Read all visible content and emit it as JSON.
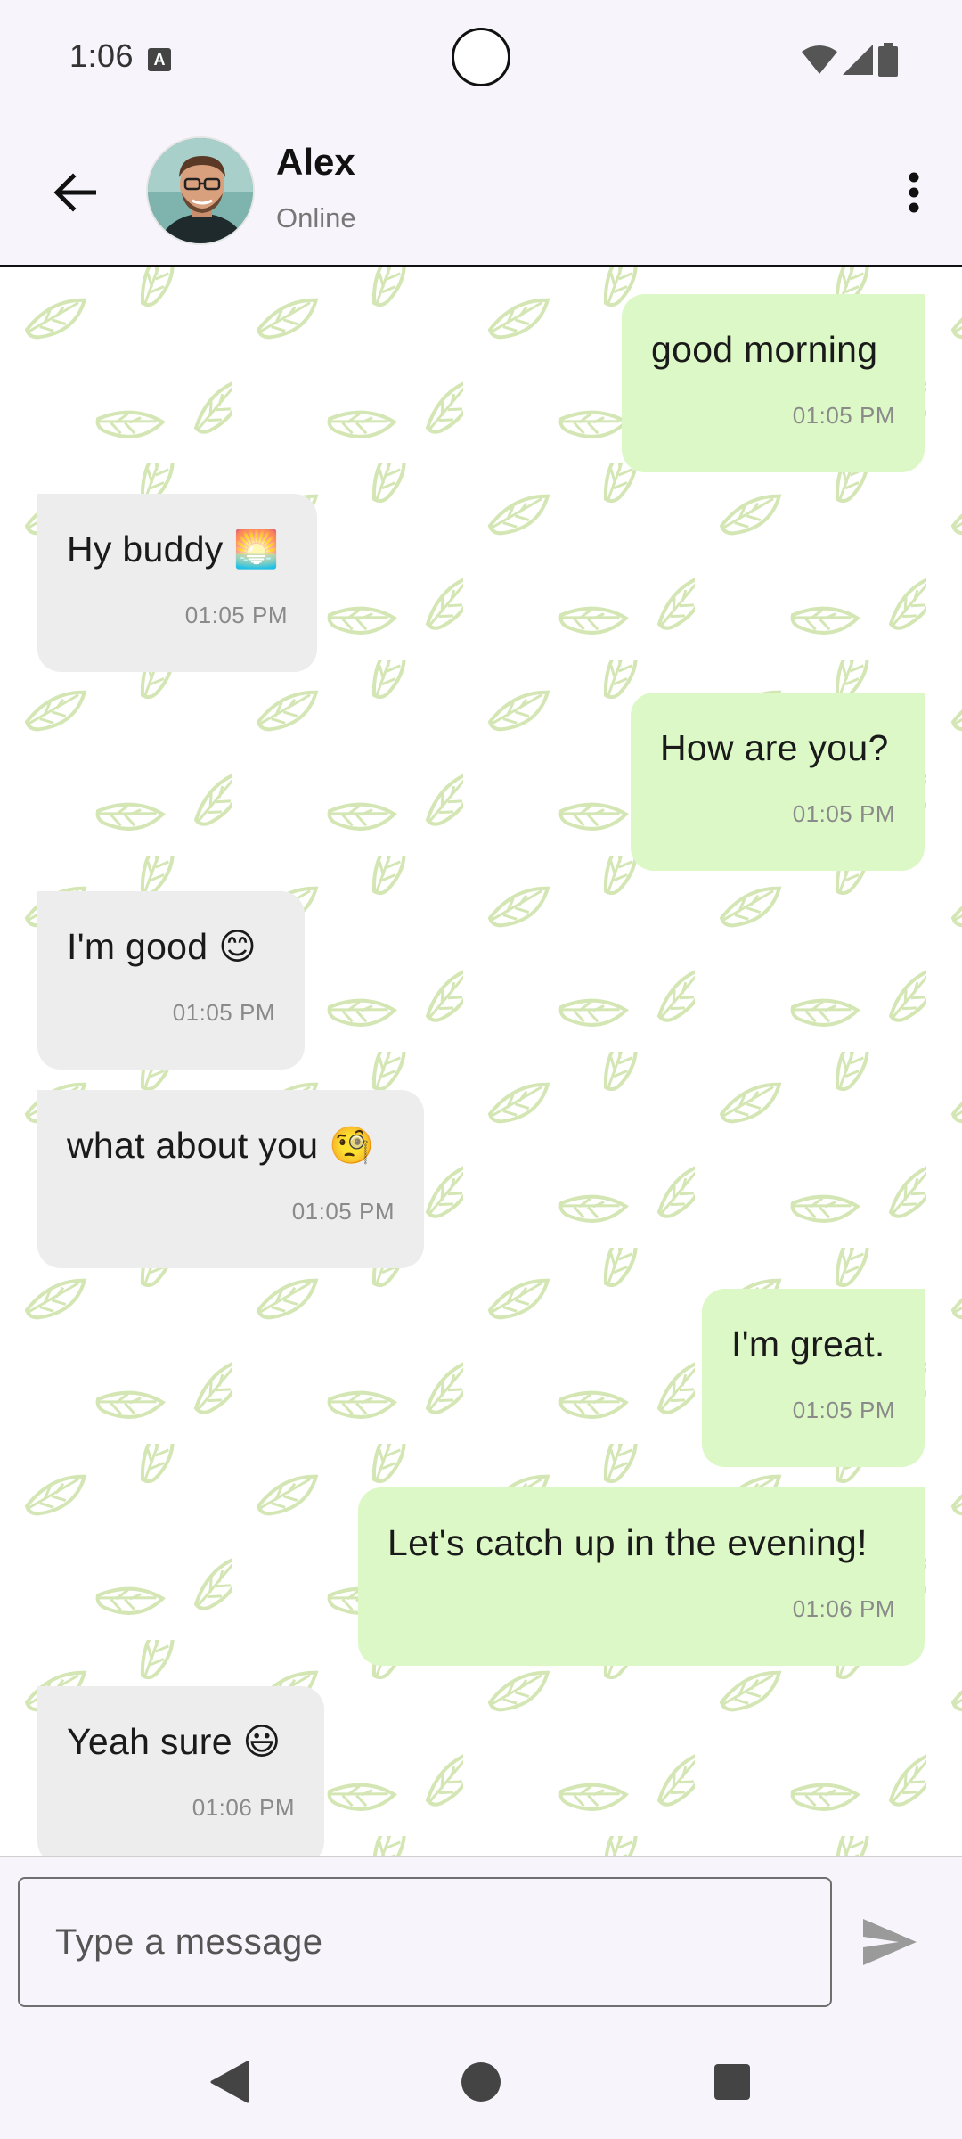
{
  "status_bar": {
    "time": "1:06",
    "notification_icon": "a-icon"
  },
  "header": {
    "back_icon": "arrow-left-icon",
    "contact_name": "Alex",
    "contact_status": "Online",
    "more_icon": "more-vertical-icon"
  },
  "messages": [
    {
      "direction": "out",
      "text": "good morning",
      "time": "01:05 PM"
    },
    {
      "direction": "in",
      "text": "Hy buddy 🌅",
      "time": "01:05 PM"
    },
    {
      "direction": "out",
      "text": "How are you?",
      "time": "01:05 PM"
    },
    {
      "direction": "in",
      "text": "I'm good 😊",
      "time": "01:05 PM"
    },
    {
      "direction": "in",
      "text": "what about you 🧐",
      "time": "01:05 PM"
    },
    {
      "direction": "out",
      "text": "I'm great.",
      "time": "01:05 PM"
    },
    {
      "direction": "out",
      "text": "Let's catch up in the evening!",
      "time": "01:06 PM"
    },
    {
      "direction": "in",
      "text": "Yeah sure 😃",
      "time": "01:06 PM"
    }
  ],
  "composer": {
    "placeholder": "Type a message",
    "value": "",
    "send_icon": "send-icon"
  },
  "colors": {
    "outgoing_bubble": "#dcf8c6",
    "incoming_bubble": "#ededed",
    "leaf_pattern": "#cde3a8",
    "bar_background": "#f7f5fb"
  },
  "nav": {
    "back": "nav-back-icon",
    "home": "nav-home-icon",
    "recents": "nav-recents-icon"
  }
}
